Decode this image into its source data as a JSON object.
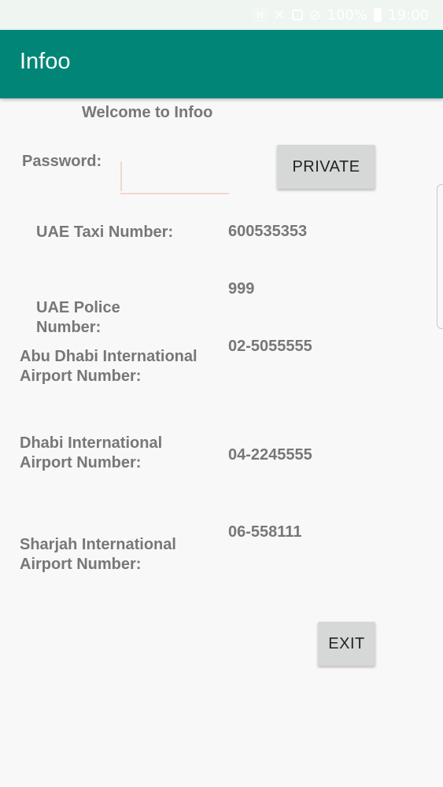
{
  "status_bar": {
    "battery": "100%",
    "time": "19:00",
    "icons": [
      "nfc-icon",
      "mute-icon",
      "notification-box-icon",
      "block-icon",
      "battery-icon"
    ]
  },
  "app_bar": {
    "title": "Infoo"
  },
  "welcome": "Welcome to Infoo",
  "password": {
    "label": "Password:",
    "value": "",
    "placeholder": ""
  },
  "private_button": "PRIVATE",
  "entries": {
    "taxi": {
      "label": "UAE Taxi Number:",
      "value": "600535353"
    },
    "police": {
      "label_line1": "UAE Police",
      "label_line2": "Number:",
      "value": "999"
    },
    "abu_dhabi": {
      "label_line1": "Abu Dhabi International",
      "label_line2": "Airport Number:",
      "value": "02-5055555"
    },
    "dhabi": {
      "label_line1": "Dhabi International",
      "label_line2": "Airport Number:",
      "value": "04-2245555"
    },
    "sharjah": {
      "label_line1": "Sharjah International",
      "label_line2": "Airport Number:",
      "value": "06-558111"
    }
  },
  "exit_button": "EXIT",
  "colors": {
    "primary": "#008577",
    "status_bar": "#eff5f0",
    "text_gray": "#777777",
    "button": "#d6d7d7",
    "input_accent": "#f3d6cc"
  }
}
